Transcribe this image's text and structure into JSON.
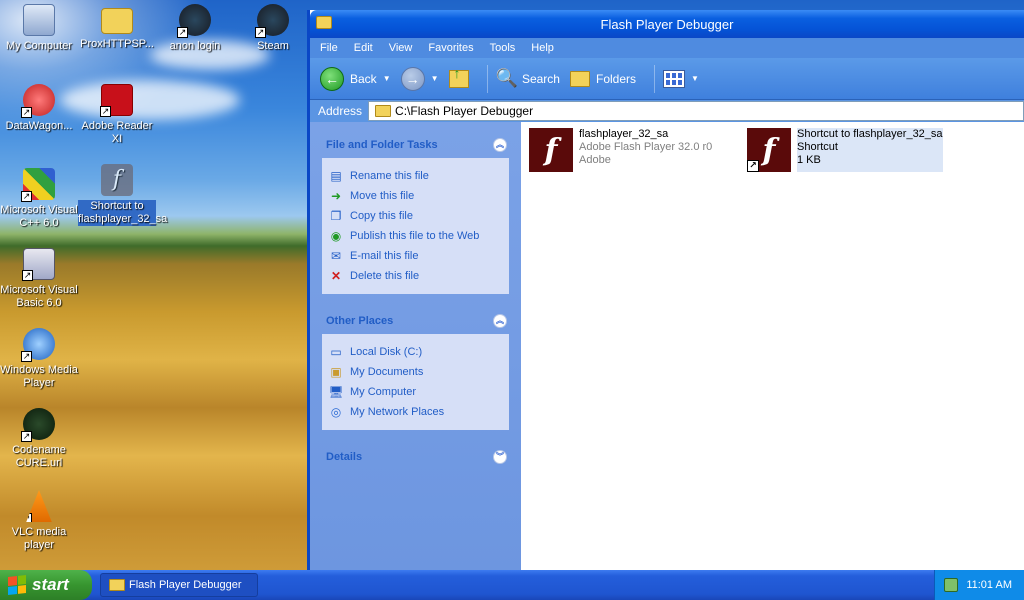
{
  "desktop": {
    "icons": [
      {
        "label": "My Computer",
        "icon": "my-computer-icon"
      },
      {
        "label": "ProxHTTPSP...",
        "icon": "folder-icon"
      },
      {
        "label": "anon login",
        "icon": "steam-icon"
      },
      {
        "label": "Steam",
        "icon": "steam-icon"
      },
      {
        "label": "DataWagon...",
        "icon": "datawagon-icon"
      },
      {
        "label": "Adobe Reader XI",
        "icon": "adobe-reader-icon"
      },
      {
        "label": "Microsoft Visual C++ 6.0",
        "icon": "visual-cpp-icon"
      },
      {
        "label": "Shortcut to flashplayer_32_sa",
        "icon": "flash-icon"
      },
      {
        "label": "Microsoft Visual Basic 6.0",
        "icon": "visual-basic-icon"
      },
      {
        "label": "Windows Media Player",
        "icon": "media-player-icon"
      },
      {
        "label": "Codename CURE.url",
        "icon": "codename-cure-icon"
      },
      {
        "label": "VLC media player",
        "icon": "vlc-icon"
      }
    ]
  },
  "window": {
    "title": "Flash Player Debugger",
    "menu": [
      "File",
      "Edit",
      "View",
      "Favorites",
      "Tools",
      "Help"
    ],
    "toolbar": {
      "back": "Back",
      "search": "Search",
      "folders": "Folders"
    },
    "address": {
      "label": "Address",
      "path": "C:\\Flash Player Debugger"
    },
    "tasks": {
      "title": "File and Folder Tasks",
      "items": [
        "Rename this file",
        "Move this file",
        "Copy this file",
        "Publish this file to the Web",
        "E-mail this file",
        "Delete this file"
      ]
    },
    "places": {
      "title": "Other Places",
      "items": [
        "Local Disk (C:)",
        "My Documents",
        "My Computer",
        "My Network Places"
      ]
    },
    "details": {
      "title": "Details"
    },
    "files": [
      {
        "name": "flashplayer_32_sa",
        "line2": "Adobe Flash Player 32.0 r0",
        "line3": "Adobe"
      },
      {
        "name": "Shortcut to flashplayer_32_sa",
        "line2": "Shortcut",
        "line3": "1 KB"
      }
    ]
  },
  "taskbar": {
    "start": "start",
    "task": "Flash Player Debugger",
    "clock": "11:01 AM"
  },
  "colors": {
    "xp_blue": "#0a47c6",
    "task_link": "#215dc6",
    "flash_red": "#5a0a0a"
  }
}
